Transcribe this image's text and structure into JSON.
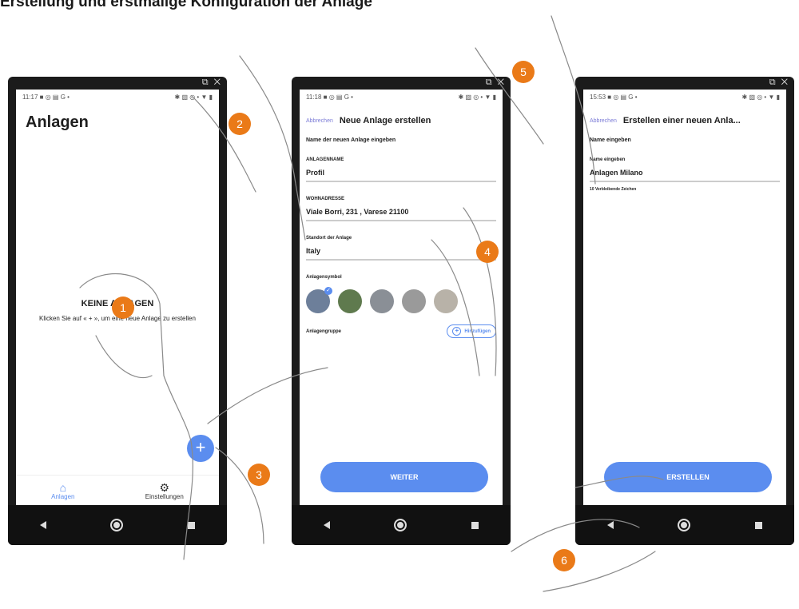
{
  "document": {
    "title": "Erstellung und erstmalige Konfiguration der Anlage"
  },
  "colors": {
    "accent": "#5b8def",
    "callout": "#ea7a18",
    "cancel": "#7b7bd6"
  },
  "window_controls": {
    "icons": [
      "external-link-icon",
      "close-icon"
    ],
    "text": "⧉ ✕"
  },
  "phone1": {
    "status_time": "11:17",
    "status_icons_left": "■ ◎ ▤ G •",
    "status_icons_right": "✱ ▧ ◎ • ▼ ▮",
    "title": "Anlagen",
    "empty_heading": "KEINE ANLAGEN",
    "empty_text": "Klicken Sie auf « + », um eine neue Anlage zu erstellen",
    "fab_label": "+",
    "tabs": [
      {
        "label": "Anlagen",
        "icon": "home-icon",
        "glyph": "⌂"
      },
      {
        "label": "Einstellungen",
        "icon": "gear-icon",
        "glyph": "⚙"
      }
    ]
  },
  "phone2": {
    "status_time": "11:18",
    "status_icons_left": "■ ◎ ▤ G •",
    "status_icons_right": "✱ ▧ ◎ • ▼ ▮",
    "cancel": "Abbrechen",
    "title": "Neue Anlage erstellen",
    "subtitle": "Name der neuen Anlage eingeben",
    "name_label": "ANLAGENNAME",
    "name_value": "Profil",
    "address_label": "WOHNADRESSE",
    "address_value": "Viale Borri, 231 , Varese 21100",
    "location_label": "Standort der Anlage",
    "location_value": "Italy",
    "symbol_label": "Anlagensymbol",
    "symbols": [
      {
        "name": "house-symbol-1",
        "color": "#6d7f9a",
        "selected": true
      },
      {
        "name": "house-symbol-2",
        "color": "#5f7a4e",
        "selected": false
      },
      {
        "name": "house-symbol-3",
        "color": "#8a8f96",
        "selected": false
      },
      {
        "name": "house-symbol-4",
        "color": "#9a9a9a",
        "selected": false
      },
      {
        "name": "house-symbol-5",
        "color": "#b8b2a8",
        "selected": false
      }
    ],
    "selected_check": "✓",
    "group_label": "Anlagengruppe",
    "add_button": "Hinzufügen",
    "add_glyph": "+",
    "next_button": "WEITER"
  },
  "phone3": {
    "status_time": "15:53",
    "status_icons_left": "■ ◎ ▤ G •",
    "status_icons_right": "✱ ▧ ◎ • ▼ ▮",
    "cancel": "Abbrechen",
    "title": "Erstellen einer neuen Anla...",
    "subtitle": "Name eingeben",
    "name_label": "Name eingeben",
    "name_value": "Anlagen Milano",
    "remaining": "10 Verbleibende Zeichen",
    "create_button": "ERSTELLEN"
  },
  "callouts": [
    "1",
    "2",
    "3",
    "4",
    "5",
    "6"
  ]
}
